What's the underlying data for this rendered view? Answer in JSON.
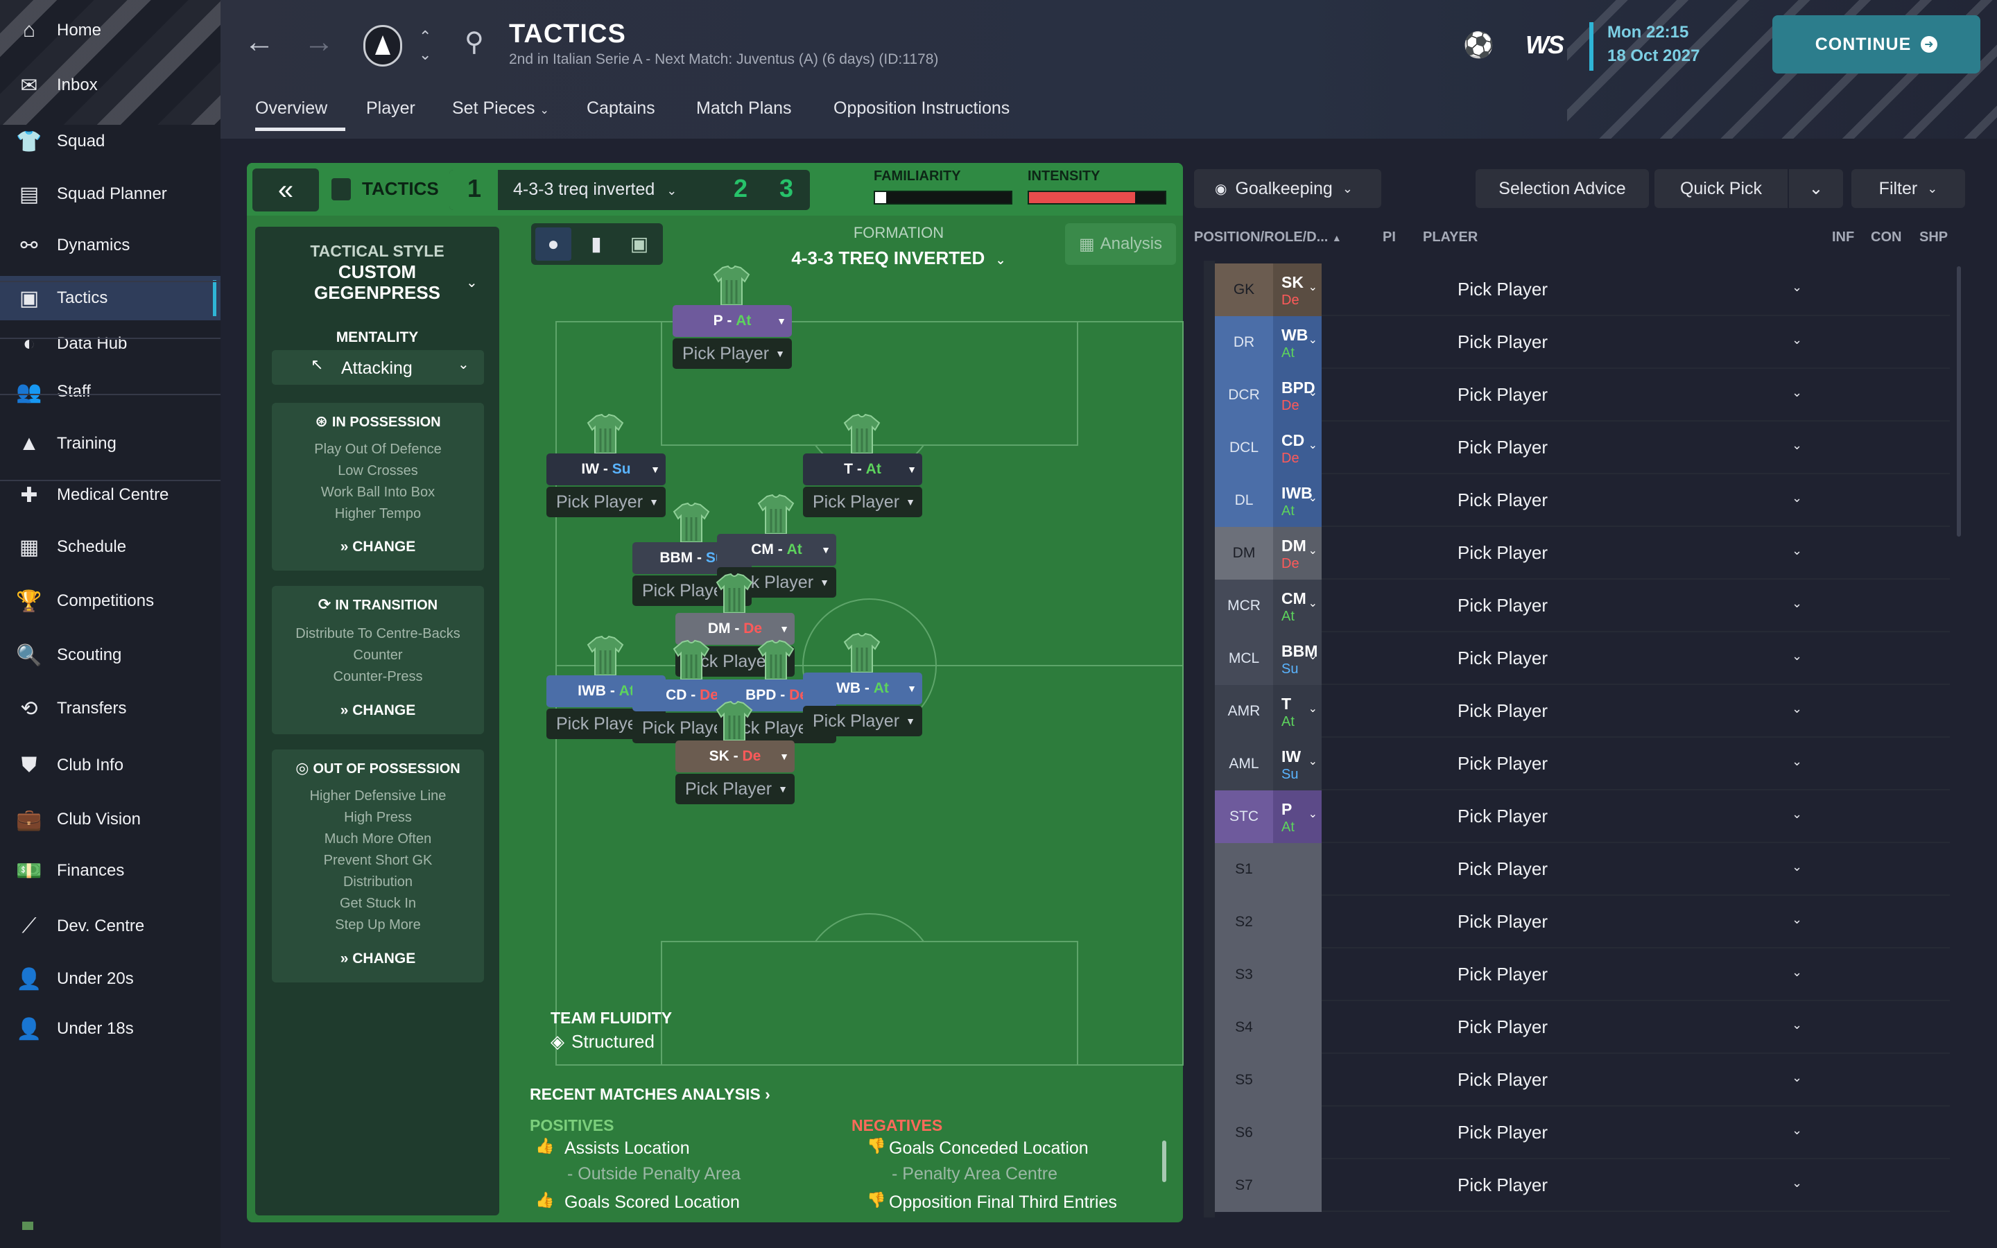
{
  "sidebar": {
    "items": [
      {
        "label": "Home",
        "icon": "home-icon",
        "glyph": "⌂"
      },
      {
        "label": "Inbox",
        "icon": "inbox-icon",
        "glyph": "✉"
      },
      {
        "label": "Squad",
        "icon": "squad-icon",
        "glyph": "👕"
      },
      {
        "label": "Squad Planner",
        "icon": "squad-planner-icon",
        "glyph": "▤"
      },
      {
        "label": "Dynamics",
        "icon": "dynamics-icon",
        "glyph": "⚯"
      },
      {
        "label": "Tactics",
        "icon": "tactics-icon",
        "glyph": "▣"
      },
      {
        "label": "Data Hub",
        "icon": "data-hub-icon",
        "glyph": "◐"
      },
      {
        "label": "Staff",
        "icon": "staff-icon",
        "glyph": "👥"
      },
      {
        "label": "Training",
        "icon": "training-icon",
        "glyph": "▲"
      },
      {
        "label": "Medical Centre",
        "icon": "medical-centre-icon",
        "glyph": "✚"
      },
      {
        "label": "Schedule",
        "icon": "schedule-icon",
        "glyph": "▦"
      },
      {
        "label": "Competitions",
        "icon": "trophy-icon",
        "glyph": "🏆"
      },
      {
        "label": "Scouting",
        "icon": "scouting-icon",
        "glyph": "🔍"
      },
      {
        "label": "Transfers",
        "icon": "transfers-icon",
        "glyph": "⟲"
      },
      {
        "label": "Club Info",
        "icon": "club-info-icon",
        "glyph": "⛊"
      },
      {
        "label": "Club Vision",
        "icon": "club-vision-icon",
        "glyph": "💼"
      },
      {
        "label": "Finances",
        "icon": "finances-icon",
        "glyph": "💵"
      },
      {
        "label": "Dev. Centre",
        "icon": "dev-centre-icon",
        "glyph": "⟋"
      },
      {
        "label": "Under 20s",
        "icon": "under-20s-icon",
        "glyph": "👤"
      },
      {
        "label": "Under 18s",
        "icon": "under-18s-icon",
        "glyph": "👤"
      }
    ]
  },
  "header": {
    "title": "TACTICS",
    "subtitle": "2nd in Italian Serie A - Next Match: Juventus (A) (6 days) (ID:1178)",
    "time": "Mon 22:15",
    "date": "18 Oct 2027",
    "continue_label": "CONTINUE",
    "brand": "WS",
    "tabs": [
      "Overview",
      "Player",
      "Set Pieces",
      "Captains",
      "Match Plans",
      "Opposition Instructions"
    ]
  },
  "tactics": {
    "label": "TACTICS",
    "slot1": "1",
    "slot2": "2",
    "slot3": "3",
    "name": "4-3-3 treq inverted",
    "familiarity_label": "FAMILIARITY",
    "intensity_label": "INTENSITY",
    "familiarity_value": 0.08,
    "intensity_value": 0.78,
    "colors": {
      "attack": "#5dd35d",
      "support": "#5ab4ff",
      "defend": "#ff5a5a",
      "accent": "#2fb5d6"
    }
  },
  "style": {
    "title_top": "TACTICAL STYLE",
    "title_main": "CUSTOM",
    "title_sub": "GEGENPRESS",
    "mentality_label": "MENTALITY",
    "mentality_value": "Attacking",
    "change": "CHANGE",
    "in_possession": {
      "title": "IN POSSESSION",
      "lines": [
        "Play Out Of Defence",
        "Low Crosses",
        "Work Ball Into Box",
        "Higher Tempo"
      ]
    },
    "in_transition": {
      "title": "IN TRANSITION",
      "lines": [
        "Distribute To Centre-Backs",
        "Counter",
        "Counter-Press"
      ]
    },
    "out_of_possession": {
      "title": "OUT OF POSSESSION",
      "lines": [
        "Higher Defensive Line",
        "High Press",
        "Much More Often",
        "Prevent Short GK",
        "Distribution",
        "Get Stuck In",
        "Step Up More"
      ]
    }
  },
  "pitch": {
    "formation_label": "FORMATION",
    "formation_name": "4-3-3 TREQ INVERTED",
    "analysis_label": "Analysis",
    "fluidity_label": "TEAM FLUIDITY",
    "fluidity_value": "Structured",
    "pick_label": "Pick Player",
    "slots": [
      {
        "role": "P",
        "duty": "At",
        "duty_class": "att",
        "color": "#6e5a9c"
      },
      {
        "role": "IW",
        "duty": "Su",
        "duty_class": "sup",
        "color": "#2b3140"
      },
      {
        "role": "T",
        "duty": "At",
        "duty_class": "att",
        "color": "#2b3140"
      },
      {
        "role": "BBM",
        "duty": "Su",
        "duty_class": "sup",
        "color": "#3b4150"
      },
      {
        "role": "CM",
        "duty": "At",
        "duty_class": "att",
        "color": "#3b4150"
      },
      {
        "role": "DM",
        "duty": "De",
        "duty_class": "def",
        "color": "#6c707a"
      },
      {
        "role": "IWB",
        "duty": "At",
        "duty_class": "att",
        "color": "#4b6ea8"
      },
      {
        "role": "CD",
        "duty": "De",
        "duty_class": "def",
        "color": "#4b6ea8"
      },
      {
        "role": "BPD",
        "duty": "De",
        "duty_class": "def",
        "color": "#4b6ea8"
      },
      {
        "role": "WB",
        "duty": "At",
        "duty_class": "att",
        "color": "#4b6ea8"
      },
      {
        "role": "SK",
        "duty": "De",
        "duty_class": "def",
        "color": "#6b5c50"
      }
    ]
  },
  "analysis": {
    "title": "RECENT MATCHES ANALYSIS",
    "positives_label": "POSITIVES",
    "negatives_label": "NEGATIVES",
    "positives": [
      {
        "main": "Assists Location",
        "sub": "- Outside Penalty Area"
      },
      {
        "main": "Goals Scored Location",
        "sub": ""
      }
    ],
    "negatives": [
      {
        "main": "Goals Conceded Location",
        "sub": "- Penalty Area Centre"
      },
      {
        "main": "Opposition Final Third Entries",
        "sub": ""
      }
    ]
  },
  "selection": {
    "goalkeeping": "Goalkeeping",
    "advice": "Selection Advice",
    "quick_pick": "Quick Pick",
    "filter": "Filter",
    "columns": {
      "position": "POSITION/ROLE/D...",
      "pi": "PI",
      "player": "PLAYER",
      "inf": "INF",
      "con": "CON",
      "shp": "SHP"
    },
    "rows": [
      {
        "pos": "GK",
        "role": "SK",
        "duty": "De",
        "duty_class": "def",
        "pos_color": "#6b5c50",
        "role_color": "#5a4d42"
      },
      {
        "pos": "DR",
        "role": "WB",
        "duty": "At",
        "duty_class": "att",
        "pos_color": "#4b6ea8",
        "role_color": "#3d5d94"
      },
      {
        "pos": "DCR",
        "role": "BPD",
        "duty": "De",
        "duty_class": "def",
        "pos_color": "#4b6ea8",
        "role_color": "#3d5d94"
      },
      {
        "pos": "DCL",
        "role": "CD",
        "duty": "De",
        "duty_class": "def",
        "pos_color": "#4b6ea8",
        "role_color": "#3d5d94"
      },
      {
        "pos": "DL",
        "role": "IWB",
        "duty": "At",
        "duty_class": "att",
        "pos_color": "#4b6ea8",
        "role_color": "#3d5d94"
      },
      {
        "pos": "DM",
        "role": "DM",
        "duty": "De",
        "duty_class": "def",
        "pos_color": "#6c707a",
        "role_color": "#5a5e68"
      },
      {
        "pos": "MCR",
        "role": "CM",
        "duty": "At",
        "duty_class": "att",
        "pos_color": "#454a58",
        "role_color": "#3b404d"
      },
      {
        "pos": "MCL",
        "role": "BBM",
        "duty": "Su",
        "duty_class": "sup",
        "pos_color": "#454a58",
        "role_color": "#3b404d"
      },
      {
        "pos": "AMR",
        "role": "T",
        "duty": "At",
        "duty_class": "att",
        "pos_color": "#3c414e",
        "role_color": "#343946"
      },
      {
        "pos": "AML",
        "role": "IW",
        "duty": "Su",
        "duty_class": "sup",
        "pos_color": "#3c414e",
        "role_color": "#343946"
      },
      {
        "pos": "STC",
        "role": "P",
        "duty": "At",
        "duty_class": "att",
        "pos_color": "#6e5a9c",
        "role_color": "#5c4a88"
      },
      {
        "pos": "S1",
        "role": "",
        "duty": "",
        "duty_class": "",
        "pos_color": "#5a5e6a",
        "role_color": "#5a5e6a"
      },
      {
        "pos": "S2",
        "role": "",
        "duty": "",
        "duty_class": "",
        "pos_color": "#5a5e6a",
        "role_color": "#5a5e6a"
      },
      {
        "pos": "S3",
        "role": "",
        "duty": "",
        "duty_class": "",
        "pos_color": "#5a5e6a",
        "role_color": "#5a5e6a"
      },
      {
        "pos": "S4",
        "role": "",
        "duty": "",
        "duty_class": "",
        "pos_color": "#5a5e6a",
        "role_color": "#5a5e6a"
      },
      {
        "pos": "S5",
        "role": "",
        "duty": "",
        "duty_class": "",
        "pos_color": "#5a5e6a",
        "role_color": "#5a5e6a"
      },
      {
        "pos": "S6",
        "role": "",
        "duty": "",
        "duty_class": "",
        "pos_color": "#5a5e6a",
        "role_color": "#5a5e6a"
      },
      {
        "pos": "S7",
        "role": "",
        "duty": "",
        "duty_class": "",
        "pos_color": "#5a5e6a",
        "role_color": "#5a5e6a"
      }
    ]
  }
}
